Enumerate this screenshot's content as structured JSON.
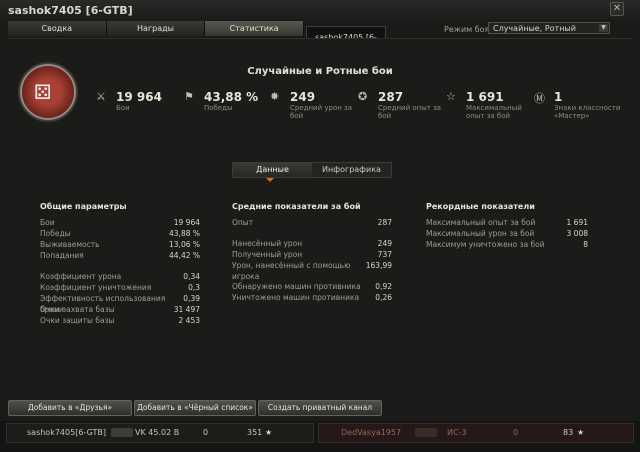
{
  "window": {
    "title": "sashok7405 [6-GTB]"
  },
  "tabs": [
    "Сводка",
    "Награды",
    "Статистика"
  ],
  "tooltip": "sashok7405 [6-GTB]",
  "mode": {
    "label": "Режим боя:",
    "value": "Случайные, Ротный"
  },
  "header_title": "Случайные и Ротные бои",
  "summary": [
    {
      "value": "19 964",
      "label": "Бои",
      "icon": "crossed-swords-icon"
    },
    {
      "value": "43,88 %",
      "label": "Победы",
      "icon": "flag-icon"
    },
    {
      "value": "249",
      "label": "Средний урон за бой",
      "icon": "damage-icon"
    },
    {
      "value": "287",
      "label": "Средний опыт за бой",
      "icon": "experience-icon"
    },
    {
      "value": "1 691",
      "label": "Максимальный опыт за бой",
      "icon": "star-icon"
    },
    {
      "value": "1",
      "label": "Знаки классности «Мастер»",
      "icon": "master-badge-icon"
    }
  ],
  "toggle": {
    "left": "Данные",
    "right": "Инфографика"
  },
  "general": {
    "title": "Общие параметры",
    "rows": [
      [
        "Бои",
        "19 964"
      ],
      [
        "Победы",
        "43,88 %"
      ],
      [
        "Выживаемость",
        "13,06 %"
      ],
      [
        "Попадания",
        "44,42 %"
      ],
      [
        "Коэффициент урона",
        "0,34"
      ],
      [
        "Коэффициент уничтожения",
        "0,3"
      ],
      [
        "Эффективность использования брони",
        "0,39"
      ],
      [
        "Очки захвата базы",
        "31 497"
      ],
      [
        "Очки защиты базы",
        "2 453"
      ]
    ]
  },
  "avg": {
    "title": "Средние показатели за бой",
    "rows": [
      [
        "Опыт",
        "287"
      ],
      [
        "Нанесённый урон",
        "249"
      ],
      [
        "Полученный урон",
        "737"
      ],
      [
        "Урон, нанесённый с помощью игрока",
        "163,99"
      ],
      [
        "Обнаружено машин противника",
        "0,92"
      ],
      [
        "Уничтожено машин противника",
        "0,26"
      ]
    ]
  },
  "records": {
    "title": "Рекордные показатели",
    "rows": [
      [
        "Максимальный опыт за бой",
        "1 691"
      ],
      [
        "Максимальный урон за бой",
        "3 008"
      ],
      [
        "Максимум уничтожено за бой",
        "8"
      ]
    ]
  },
  "buttons": [
    "Добавить в «Друзья»",
    "Добавить в «Чёрный список»",
    "Создать приватный канал"
  ],
  "bottom": {
    "left": {
      "player": "sashok7405[6-GTB]",
      "tank": "VK 45.02 B",
      "a": "0",
      "b": "351"
    },
    "right": {
      "player": "DedVasya1957",
      "tank": "ИС-3",
      "a": "0",
      "b": "83"
    }
  }
}
